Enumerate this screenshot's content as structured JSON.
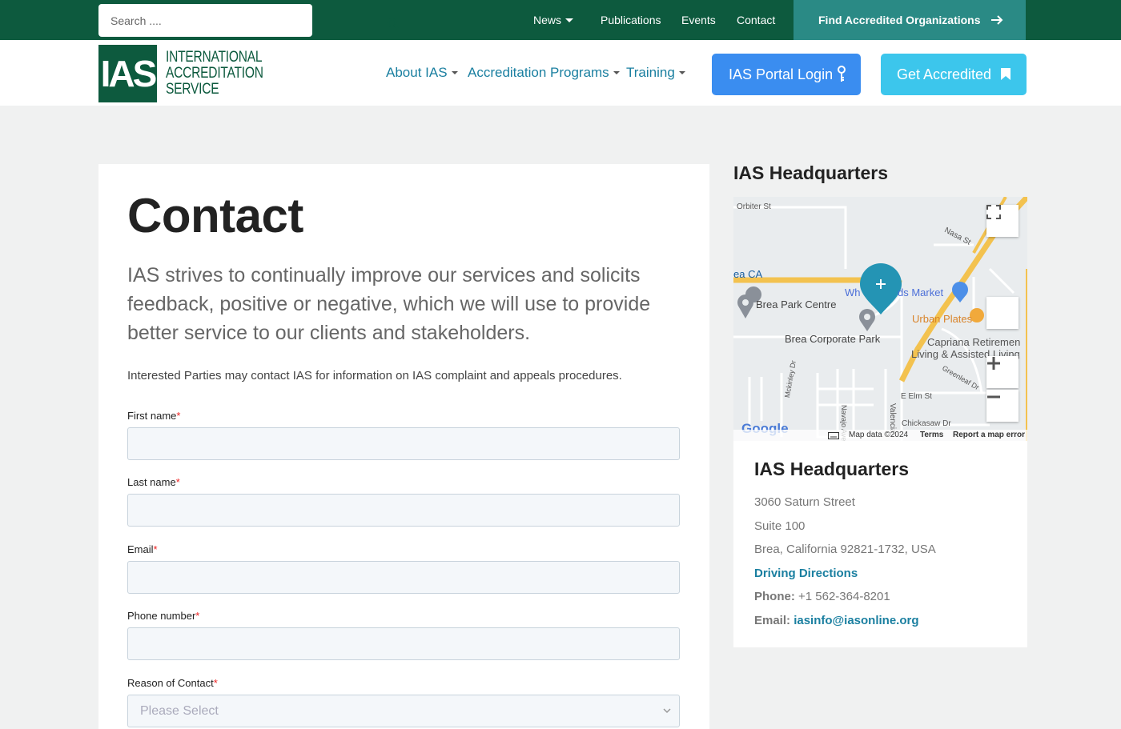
{
  "topbar": {
    "search_placeholder": "Search ....",
    "nav": [
      {
        "label": "News"
      },
      {
        "label": "Publications"
      },
      {
        "label": "Events"
      },
      {
        "label": "Contact"
      }
    ],
    "cta_label": "Find Accredited Organizations"
  },
  "header": {
    "logo_mark": "IAS",
    "logo_lines": [
      "INTERNATIONAL",
      "ACCREDITATION",
      "SERVICE"
    ],
    "nav": [
      {
        "label": "About IAS"
      },
      {
        "label": "Accreditation Programs"
      },
      {
        "label": "Training"
      }
    ],
    "portal_label": "IAS Portal Login",
    "get_accredited_label": "Get Accredited"
  },
  "main": {
    "title": "Contact",
    "lead": "IAS strives to continually improve our services and solicits feedback, positive or negative, which we will use to provide better service to our clients and stakeholders.",
    "note": "Interested Parties may contact IAS for information on IAS complaint and appeals procedures.",
    "form": {
      "first_name_label": "First name",
      "last_name_label": "Last name",
      "email_label": "Email",
      "phone_label": "Phone number",
      "reason_label": "Reason of Contact",
      "reason_value": "Please Select",
      "required_mark": "*"
    }
  },
  "sidebar": {
    "title": "IAS Headquarters",
    "map": {
      "labels": [
        "Orbiter St",
        "Nasa St",
        "ea CA",
        "Brea Park Centre",
        "Wh",
        "ds Market",
        "Urban Plates",
        "Brea Corporate Park",
        "Capriana Retiremen",
        "Living & Assisted Living",
        "Greenleaf Dr",
        "E Elm St",
        "Navajo Ave",
        "Valencia",
        "Chickasaw Dr",
        "Mckinley Dr"
      ],
      "footer_data": "Map data ©2024",
      "footer_terms": "Terms",
      "footer_report": "Report a map error",
      "google": "Google"
    },
    "info": {
      "title": "IAS Headquarters",
      "address1": "3060 Saturn Street",
      "address2": "Suite 100",
      "address3": "Brea, California 92821-1732, USA",
      "directions_label": "Driving Directions",
      "phone_label": "Phone:",
      "phone": "+1 562-364-8201",
      "email_label": "Email:",
      "email": "iasinfo@iasonline.org"
    }
  },
  "colors": {
    "topbar": "#0d5a3e",
    "cta": "#2a8a85",
    "link": "#1a7fa0",
    "portal": "#3a8df0",
    "get_accredited": "#3cc6ec"
  }
}
